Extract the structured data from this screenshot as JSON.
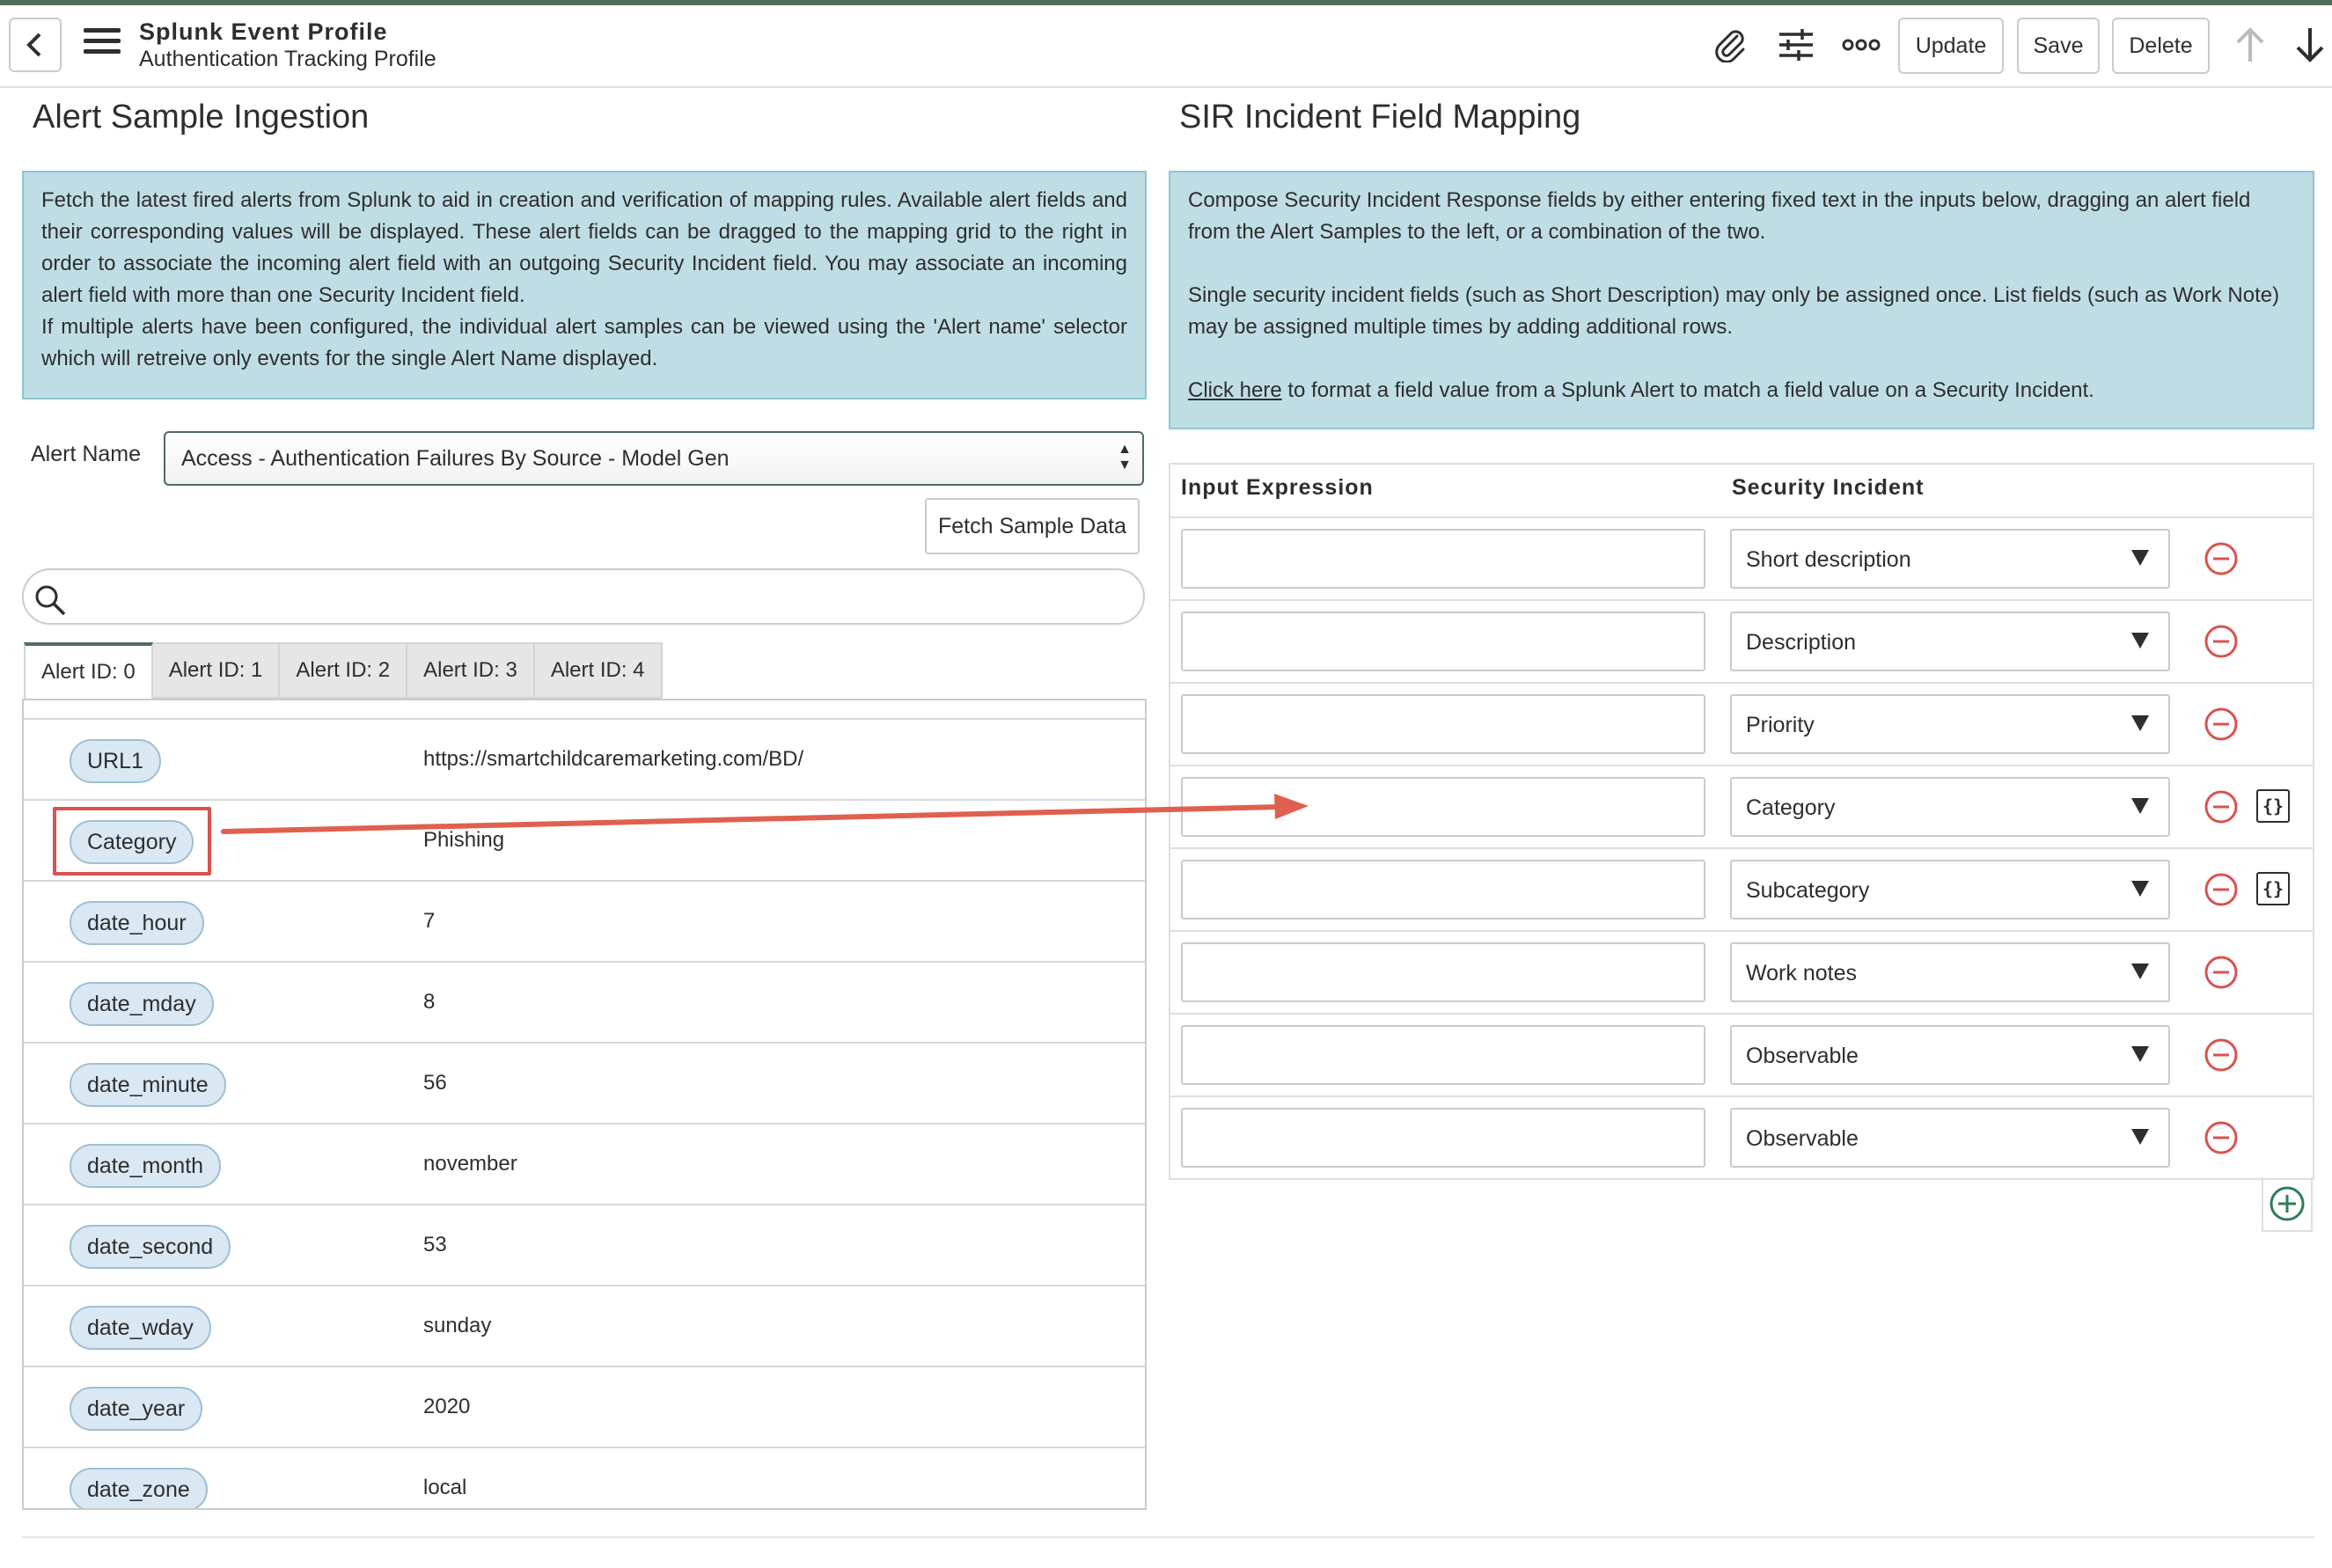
{
  "header": {
    "record_type": "Splunk Event Profile",
    "record_name": "Authentication Tracking Profile",
    "icons": [
      "chevron-left-icon",
      "hamburger-menu-icon",
      "paperclip-icon",
      "sliders-icon",
      "more-icon",
      "arrow-up-icon",
      "arrow-down-icon"
    ],
    "buttons": {
      "update": "Update",
      "save": "Save",
      "delete": "Delete"
    }
  },
  "left": {
    "title": "Alert Sample Ingestion",
    "info": [
      "Fetch the latest fired alerts from Splunk to aid in creation and verification of mapping rules. Available alert fields and their corresponding values will be displayed. These alert fields can be dragged to the mapping grid to the right in order to associate the incoming alert field with an outgoing Security Incident field. You may associate an incoming alert field with more than one Security Incident field.",
      "If multiple alerts have been configured, the individual alert samples can be viewed using the 'Alert name' selector which will retreive only events for the single Alert Name displayed."
    ],
    "alert_name_label": "Alert Name",
    "alert_name_value": "Access - Authentication Failures By Source - Model Gen",
    "fetch_button": "Fetch Sample Data",
    "search_placeholder": "",
    "tabs": [
      "Alert ID: 0",
      "Alert ID: 1",
      "Alert ID: 2",
      "Alert ID: 3",
      "Alert ID: 4"
    ],
    "active_tab": 0,
    "fields": [
      {
        "name": "URL1",
        "value": "https://smartchildcaremarketing.com/BD/"
      },
      {
        "name": "Category",
        "value": "Phishing"
      },
      {
        "name": "date_hour",
        "value": "7"
      },
      {
        "name": "date_mday",
        "value": "8"
      },
      {
        "name": "date_minute",
        "value": "56"
      },
      {
        "name": "date_month",
        "value": "november"
      },
      {
        "name": "date_second",
        "value": "53"
      },
      {
        "name": "date_wday",
        "value": "sunday"
      },
      {
        "name": "date_year",
        "value": "2020"
      },
      {
        "name": "date_zone",
        "value": "local"
      }
    ]
  },
  "right": {
    "title": "SIR Incident Field Mapping",
    "info_p1": "Compose Security Incident Response fields by either entering fixed text in the inputs below, dragging an alert field from the Alert Samples to the left, or a combination of the two.",
    "info_p2": "Single security incident fields (such as Short Description) may only be assigned once. List fields (such as Work Note) may be assigned multiple times by adding additional rows.",
    "info_link": "Click here",
    "info_p3_rest": " to format a field value from a Splunk Alert to match a field value on a Security Incident.",
    "col_input": "Input Expression",
    "col_incident": "Security Incident",
    "rows": [
      {
        "field": "Short description",
        "expr": "",
        "format": ""
      },
      {
        "field": "Description",
        "expr": "",
        "format": ""
      },
      {
        "field": "Priority",
        "expr": "",
        "format": ""
      },
      {
        "field": "Category",
        "expr": "",
        "format": "{}"
      },
      {
        "field": "Subcategory",
        "expr": "",
        "format": "{}"
      },
      {
        "field": "Work notes",
        "expr": "",
        "format": ""
      },
      {
        "field": "Observable",
        "expr": "",
        "format": ""
      },
      {
        "field": "Observable",
        "expr": "",
        "format": ""
      }
    ]
  },
  "colors": {
    "accent": "#4f6b5c",
    "info_bg": "#bfdde4",
    "pill_bg": "#d9e8f3",
    "danger": "#d9534f",
    "add": "#2e7d5b"
  }
}
